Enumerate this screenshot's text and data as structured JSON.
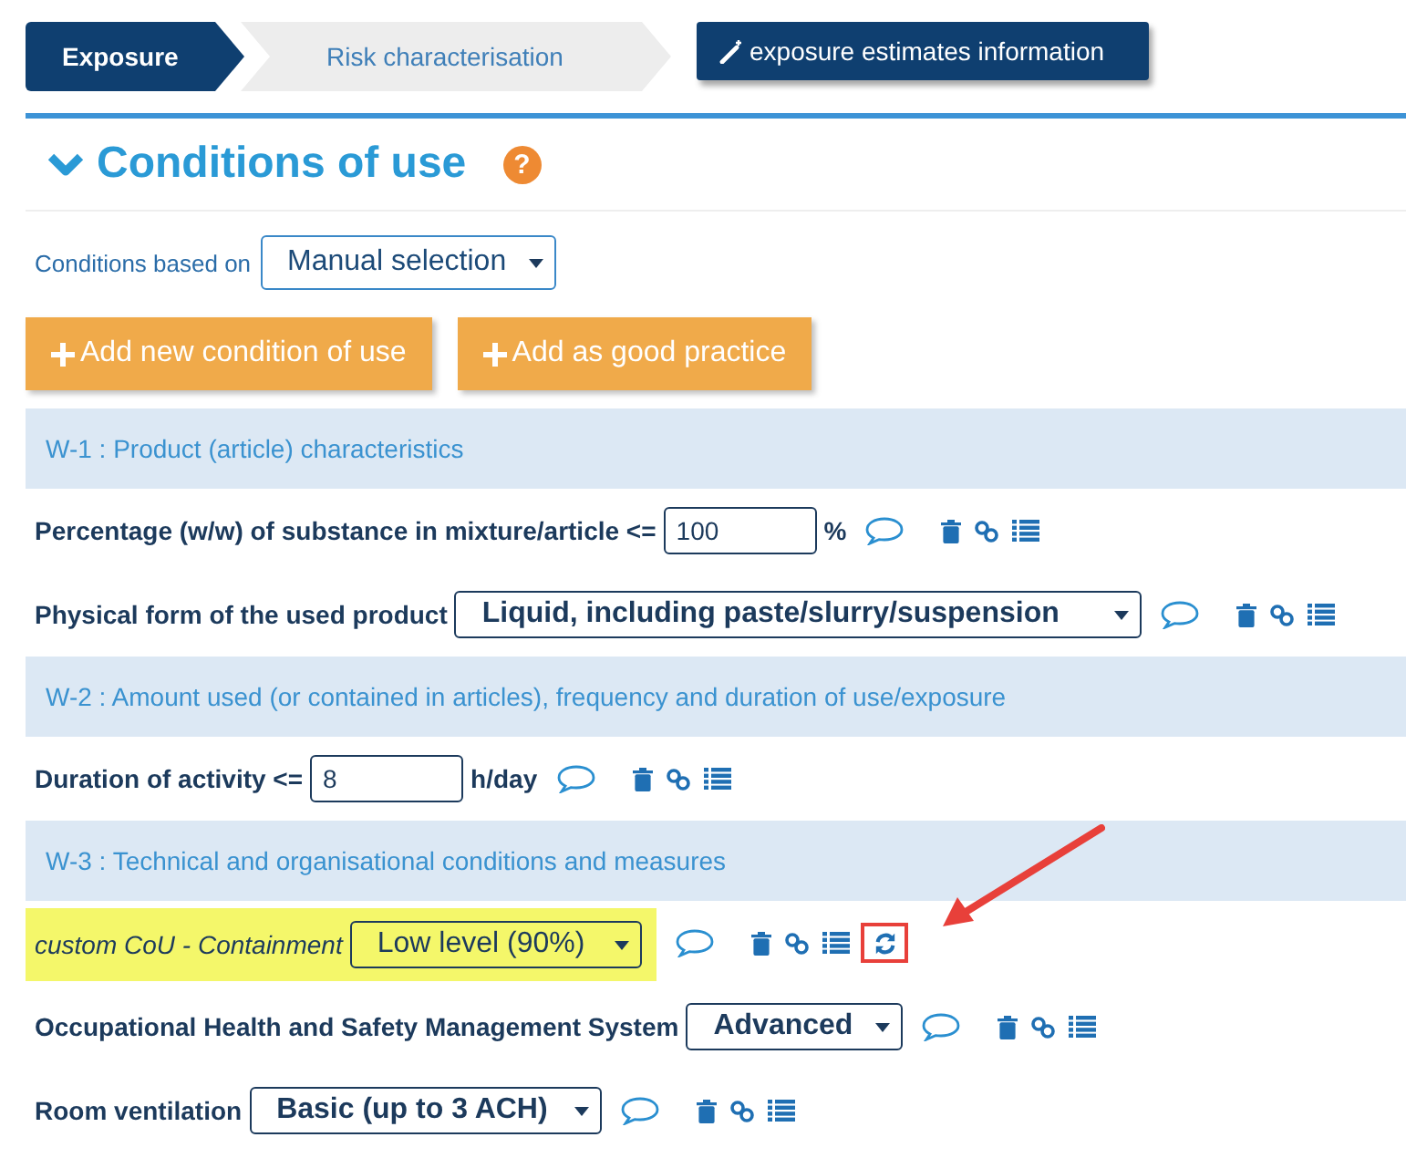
{
  "steps": [
    {
      "label": "Exposure",
      "selected": true
    },
    {
      "label": "Risk characterisation",
      "selected": false
    }
  ],
  "info_button": "exposure estimates information",
  "section": {
    "title": "Conditions of use",
    "expanded": true,
    "help": "?"
  },
  "based_on": {
    "label": "Conditions based on",
    "value": "Manual selection"
  },
  "buttons": [
    "Add new condition of use",
    "Add as good practice"
  ],
  "rows": [
    {
      "kind": "group",
      "text": "W-1 : Product (article) characteristics"
    },
    {
      "kind": "input",
      "label": "Percentage (w/w) of substance in mixture/article <=",
      "value": "100",
      "unit": "%",
      "highlighted": false,
      "custom": false,
      "annotated": false
    },
    {
      "kind": "select",
      "label": "Physical form of the used product",
      "value": "Liquid, including paste/slurry/suspension",
      "highlighted": false,
      "custom": false,
      "annotated": false
    },
    {
      "kind": "group",
      "text": "W-2 : Amount used (or contained in articles), frequency and duration of use/exposure"
    },
    {
      "kind": "input",
      "label": "Duration of activity <=",
      "value": "8",
      "unit": "h/day",
      "highlighted": false,
      "custom": false,
      "annotated": false
    },
    {
      "kind": "group",
      "text": "W-3 : Technical and organisational conditions and measures"
    },
    {
      "kind": "select",
      "label": "custom CoU - Containment",
      "value": "Low level (90%)",
      "highlighted": true,
      "custom": true,
      "annotated": true
    },
    {
      "kind": "select",
      "label": "Occupational Health and Safety Management System",
      "value": "Advanced",
      "highlighted": false,
      "custom": false,
      "annotated": false
    },
    {
      "kind": "select",
      "label": "Room ventilation",
      "value": "Basic (up to 3 ACH)",
      "highlighted": false,
      "custom": false,
      "annotated": false
    }
  ]
}
